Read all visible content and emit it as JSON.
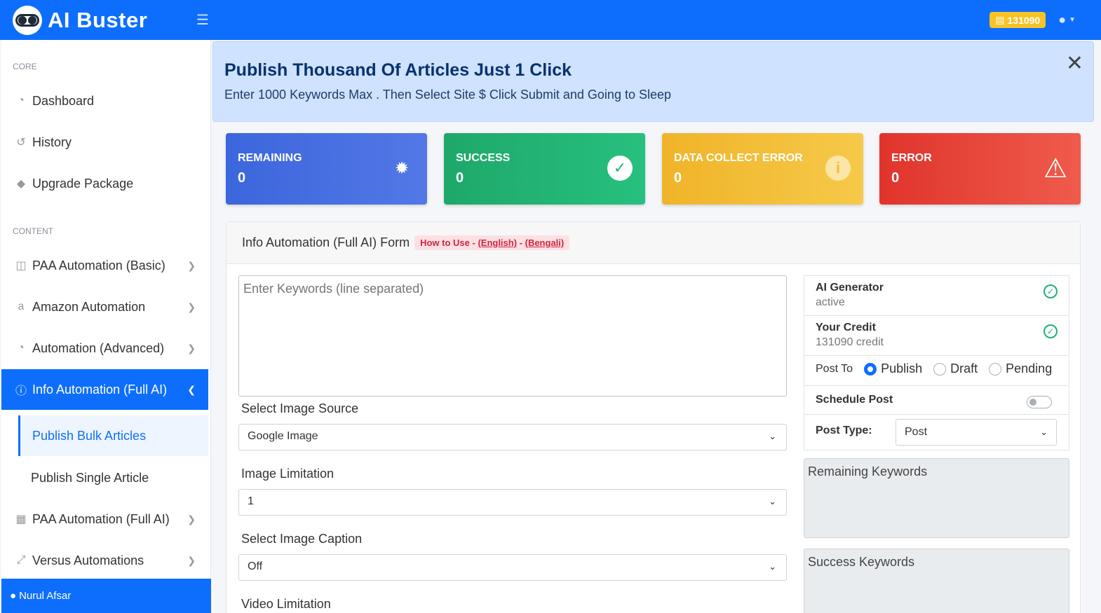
{
  "brand": {
    "name": "AI Buster"
  },
  "topbar": {
    "credits": "131090"
  },
  "sidebar": {
    "core_heading": "CORE",
    "content_heading": "CONTENT",
    "dashboard": "Dashboard",
    "history": "History",
    "upgrade": "Upgrade Package",
    "paa_basic": "PAA Automation (Basic)",
    "amazon": "Amazon Automation",
    "advanced": "Automation (Advanced)",
    "info_full_ai": "Info Automation (Full AI)",
    "publish_bulk": "Publish Bulk Articles",
    "publish_single": "Publish Single Article",
    "paa_full_ai": "PAA Automation (Full AI)",
    "versus": "Versus Automations",
    "user_name": "Nurul Afsar"
  },
  "alert": {
    "title": "Publish Thousand Of Articles Just 1 Click",
    "text": "Enter 1000 Keywords Max . Then Select Site $ Click Submit and Going to Sleep"
  },
  "stats": {
    "remaining_label": "REMAINING",
    "remaining_value": "0",
    "success_label": "SUCCESS",
    "success_value": "0",
    "dce_label": "DATA COLLECT ERROR",
    "dce_value": "0",
    "error_label": "ERROR",
    "error_value": "0"
  },
  "form": {
    "title": "Info Automation (Full AI) Form",
    "howto_prefix": "How to Use - ",
    "howto_english": "(English)",
    "howto_sep": " - ",
    "howto_bengali": "(Bengali)",
    "keywords_placeholder": "Enter Keywords (line separated)",
    "image_source_label": "Select Image Source",
    "image_source_value": "Google Image",
    "image_limit_label": "Image Limitation",
    "image_limit_value": "1",
    "image_caption_label": "Select Image Caption",
    "image_caption_value": "Off",
    "video_limit_label": "Video Limitation"
  },
  "panel": {
    "ai_gen_title": "AI Generator",
    "ai_gen_status": "active",
    "credit_title": "Your Credit",
    "credit_value": "131090 credit",
    "post_to_label": "Post To",
    "opt_publish": "Publish",
    "opt_draft": "Draft",
    "opt_pending": "Pending",
    "schedule_label": "Schedule Post",
    "post_type_label": "Post Type:",
    "post_type_value": "Post",
    "remaining_kw": "Remaining Keywords",
    "success_kw": "Success Keywords"
  }
}
